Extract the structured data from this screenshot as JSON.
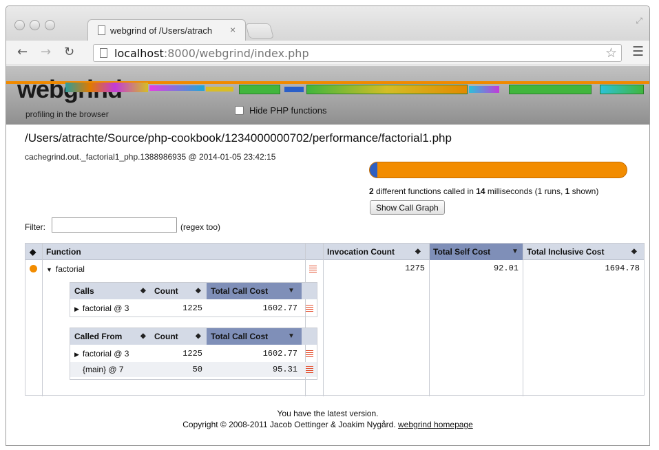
{
  "browser": {
    "tab_title": "webgrind of /Users/atrach",
    "tab_close": "×",
    "url_host": "localhost",
    "url_rest": ":8000/webgrind/index.php"
  },
  "header": {
    "logo": "webgrind",
    "tagline": "profiling in the browser",
    "hide_php_label": "Hide PHP functions",
    "hide_php_checked": false
  },
  "file": {
    "path": "/Users/atrachte/Source/php-cookbook/1234000000702/performance/factorial1.php",
    "info": "cachegrind.out._factorial1_php.1388986935 @ 2014-01-05 23:42:15"
  },
  "summary": {
    "functions": "2",
    "text1": " different functions called in ",
    "ms": "14",
    "text2": " milliseconds (1 runs, ",
    "shown": "1",
    "text3": " shown)",
    "progress_fraction": 0.03
  },
  "call_graph_button": "Show Call Graph",
  "filter": {
    "label": "Filter:",
    "value": "",
    "hint": "(regex too)"
  },
  "main_table": {
    "headers": {
      "sort": "◆",
      "function": "Function",
      "invocation": "Invocation Count",
      "self": "Total Self Cost",
      "inclusive": "Total Inclusive Cost"
    },
    "row": {
      "name": "factorial",
      "invocation_count": "1275",
      "self_cost": "92.01",
      "inclusive_cost": "1694.78"
    }
  },
  "calls_table": {
    "headers": {
      "first": "Calls",
      "count": "Count",
      "cost": "Total Call Cost"
    },
    "rows": [
      {
        "name": "factorial @ 3",
        "count": "1225",
        "cost": "1602.77"
      }
    ]
  },
  "called_from_table": {
    "headers": {
      "first": "Called From",
      "count": "Count",
      "cost": "Total Call Cost"
    },
    "rows": [
      {
        "name": "factorial @ 3",
        "count": "1225",
        "cost": "1602.77"
      },
      {
        "name": "{main} @ 7",
        "count": "50",
        "cost": "95.31"
      }
    ]
  },
  "footer": {
    "line1": "You have the latest version.",
    "line2": "Copyright © 2008-2011 Jacob Oettinger & Joakim Nygård. ",
    "link": "webgrind homepage"
  },
  "colors": {
    "header_blue": "#d4dae6",
    "selected_header": "#7f8fb8",
    "progress_orange": "#f28c00",
    "progress_blue": "#2f5fc0"
  }
}
